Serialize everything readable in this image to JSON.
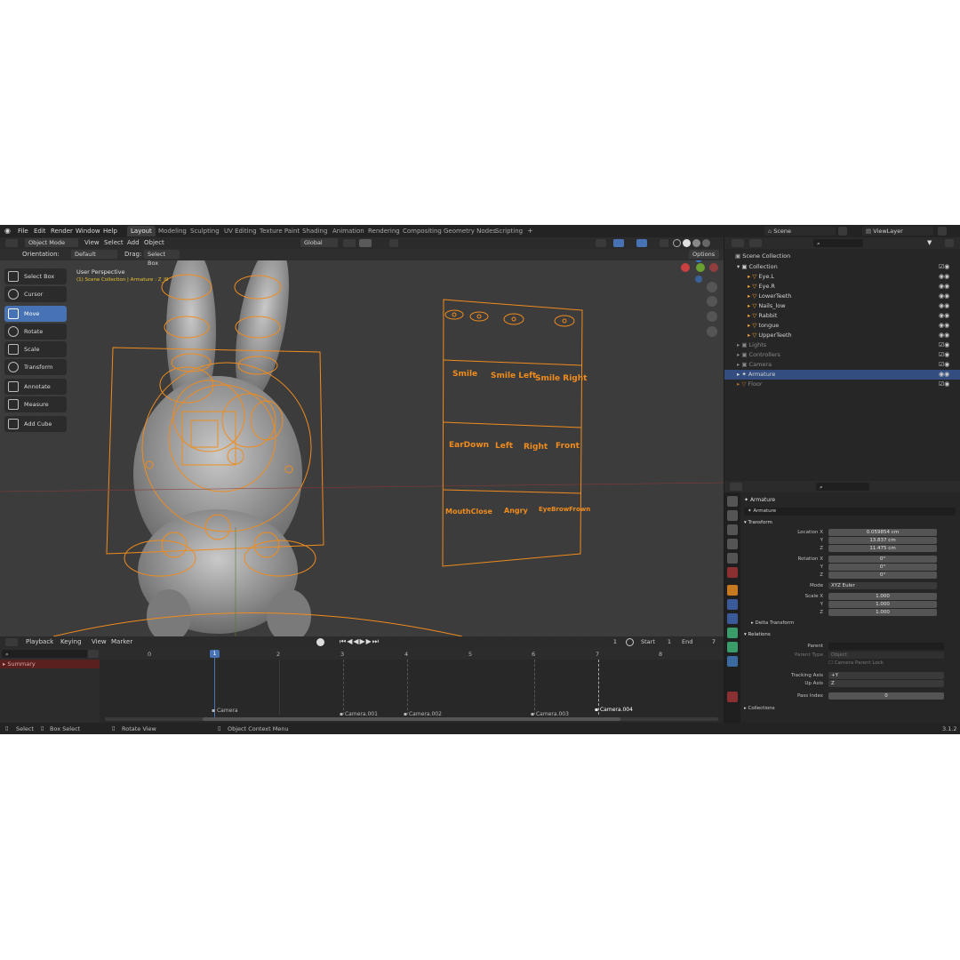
{
  "menu": [
    "File",
    "Edit",
    "Render",
    "Window",
    "Help"
  ],
  "workspaces": [
    "Layout",
    "Modeling",
    "Sculpting",
    "UV Editing",
    "Texture Paint",
    "Shading",
    "Animation",
    "Rendering",
    "Compositing",
    "Geometry Nodes",
    "Scripting"
  ],
  "scene_label": "Scene",
  "viewlayer_label": "ViewLayer",
  "viewport": {
    "mode": "Object Mode",
    "menus": [
      "View",
      "Select",
      "Add",
      "Object"
    ],
    "transform_orientation": "Global",
    "orientation_label": "Orientation:",
    "orientation_value": "Default",
    "drag_label": "Drag:",
    "drag_value": "Select Box",
    "options": "Options",
    "perspective": "User Perspective",
    "collection_info": "(1) Scene Collection | Armature : Z_l9"
  },
  "tools": [
    "Select Box",
    "Cursor",
    "Move",
    "Rotate",
    "Scale",
    "Transform",
    "Annotate",
    "Measure",
    "Add Cube"
  ],
  "face_board": {
    "row1": [
      "Smile",
      "Smile Left",
      "Smile Right"
    ],
    "row2": [
      "EarDown",
      "Left",
      "Right",
      "Front"
    ],
    "row3": [
      "MouthClose",
      "Angry",
      "EyeBrowFrown"
    ]
  },
  "timeline": {
    "menus": [
      "Playback",
      "Keying",
      "View",
      "Marker"
    ],
    "current_frame": "1",
    "start_label": "Start",
    "start": "1",
    "end_label": "End",
    "end": "7",
    "summary": "Summary",
    "ticks": [
      "0",
      "1",
      "2",
      "3",
      "4",
      "5",
      "6",
      "7",
      "8"
    ],
    "markers": [
      "Camera",
      "Camera.001",
      "Camera.002",
      "Camera.003",
      "Camera.004"
    ]
  },
  "outliner": {
    "root": "Scene Collection",
    "items": [
      {
        "label": "Collection"
      },
      {
        "label": "Eye.L"
      },
      {
        "label": "Eye.R"
      },
      {
        "label": "LowerTeeth"
      },
      {
        "label": "Nails_low"
      },
      {
        "label": "Rabbit"
      },
      {
        "label": "tongue"
      },
      {
        "label": "UpperTeeth"
      },
      {
        "label": "Lights"
      },
      {
        "label": "Controllers"
      },
      {
        "label": "Camera"
      },
      {
        "label": "Armature"
      },
      {
        "label": "Floor"
      }
    ]
  },
  "properties": {
    "object_name": "Armature",
    "data_name": "Armature",
    "transform_header": "Transform",
    "location_label": "Location X",
    "location": [
      "0.059854 cm",
      "13.837 cm",
      "11.475 cm"
    ],
    "rotation_label": "Rotation X",
    "rotation": [
      "0°",
      "0°",
      "0°"
    ],
    "mode_label": "Mode",
    "mode_value": "XYZ Euler",
    "scale_label": "Scale X",
    "scale": [
      "1.000",
      "1.000",
      "1.000"
    ],
    "axis_y": "Y",
    "axis_z": "Z",
    "delta": "Delta Transform",
    "relations": "Relations",
    "parent_label": "Parent",
    "parent_type_label": "Parent Type",
    "parent_type_value": "Object",
    "camera_parent_lock": "Camera Parent Lock",
    "tracking_label": "Tracking Axis",
    "tracking_value": "+Y",
    "up_label": "Up Axis",
    "up_value": "Z",
    "pass_label": "Pass Index",
    "pass_value": "0",
    "collections": "Collections"
  },
  "status": {
    "select": "Select",
    "box_select": "Box Select",
    "rotate_view": "Rotate View",
    "context_menu": "Object Context Menu",
    "version": "3.1.2"
  },
  "colors": {
    "accent": "#4772b3",
    "wire": "#f08c1e",
    "timeline_cursor": "#4772b3"
  }
}
